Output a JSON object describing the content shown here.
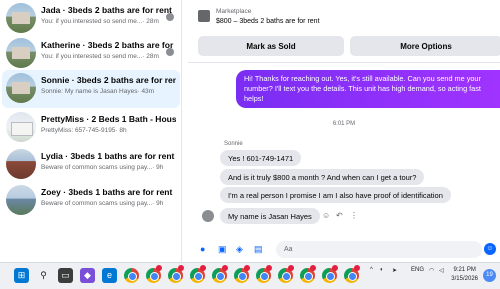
{
  "sidebar": {
    "conversations": [
      {
        "title": "Jada · 3beds 2 baths are for rent",
        "snippet": "You: if you interested so send me...",
        "time": "· 28m"
      },
      {
        "title": "Katherine · 3beds 2 baths are for rent",
        "snippet": "You: if you interested so send me...",
        "time": "· 28m"
      },
      {
        "title": "Sonnie · 3beds 2 baths are for rent",
        "snippet": "Sonnie: My name is Jasan Hayes",
        "time": "· 43m"
      },
      {
        "title": "PrettyMiss · 2 Beds 1 Bath - House",
        "snippet": "PrettyMiss: 657-745-9195",
        "time": "· 8h"
      },
      {
        "title": "Lydia · 3beds 1 baths are for rent",
        "snippet": "Beware of common scams using pay...",
        "time": "· 9h"
      },
      {
        "title": "Zoey · 3beds 1 baths are for rent",
        "snippet": "Beware of common scams using pay...",
        "time": "· 9h"
      }
    ]
  },
  "header": {
    "marketplace_label": "Marketplace",
    "listing_title": "$800 – 3beds 2 baths are for rent",
    "mark_sold_label": "Mark as Sold",
    "more_options_label": "More Options"
  },
  "thread": {
    "outgoing_message": "Hi! Thanks for reaching out. Yes, it's still available. Can you send me your number? I'll text you the details. This unit has high demand, so acting fast helps!",
    "time_divider": "6:01 PM",
    "sender_name": "Sonnie",
    "incoming": [
      "Yes ! 601-749-1471",
      "And is it truly $800 a month ? And when can I get a tour?",
      "I'm a real person I promise I am I also have proof of identification",
      "My name is Jasan Hayes"
    ]
  },
  "compose": {
    "placeholder": "Aa"
  },
  "taskbar": {
    "lang": "ENG",
    "time": "9:21 PM",
    "date": "3/15/2026",
    "notif_count": "19"
  },
  "colors": {
    "accent": "#0866ff",
    "outgoing_bubble": "#8b2cf5",
    "incoming_bubble": "#e4e6eb",
    "active_conv": "#e7f3ff"
  }
}
